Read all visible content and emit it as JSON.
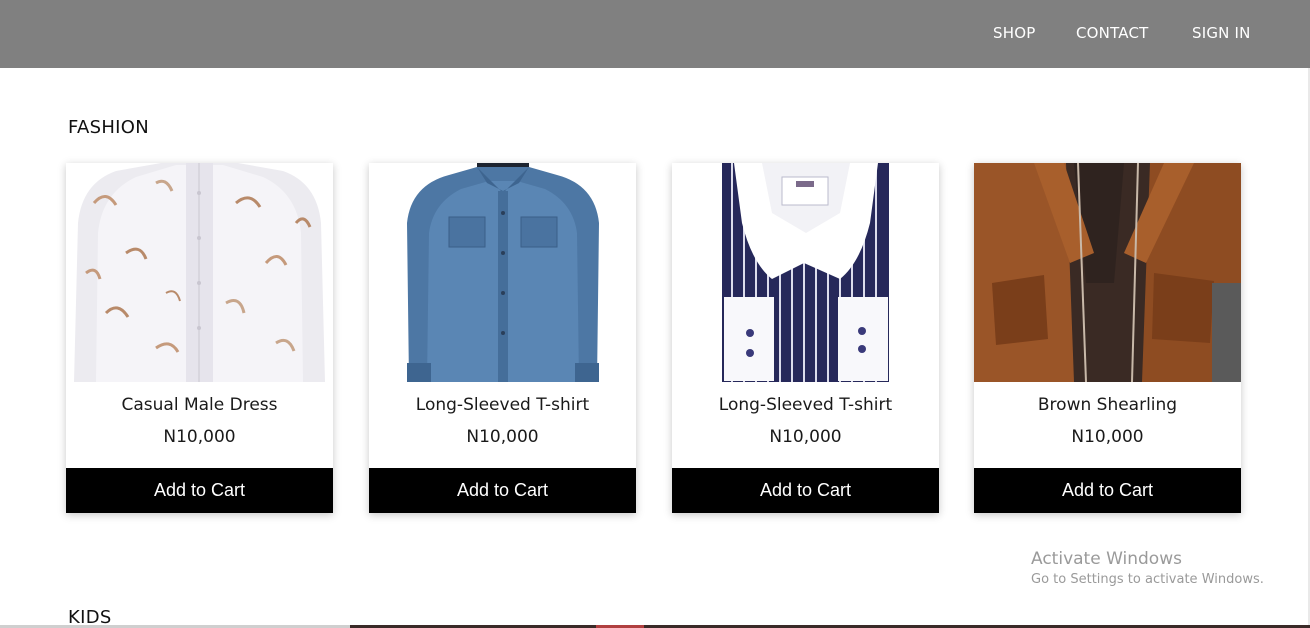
{
  "nav": {
    "shop": "SHOP",
    "contact": "CONTACT",
    "sign_in": "SIGN IN"
  },
  "sections": {
    "fashion": "FASHION",
    "kids": "KIDS"
  },
  "products": [
    {
      "name": "Casual Male Dress",
      "price": "N10,000",
      "button": "Add to Cart",
      "image": "white-patterned-shirt"
    },
    {
      "name": "Long-Sleeved T-shirt",
      "price": "N10,000",
      "button": "Add to Cart",
      "image": "denim-shirt"
    },
    {
      "name": "Long-Sleeved T-shirt",
      "price": "N10,000",
      "button": "Add to Cart",
      "image": "striped-shirt"
    },
    {
      "name": "Brown Shearling",
      "price": "N10,000",
      "button": "Add to Cart",
      "image": "brown-jacket"
    }
  ],
  "watermark": {
    "title": "Activate Windows",
    "subtitle": "Go to Settings to activate Windows."
  },
  "colors": {
    "header_bg": "#808080",
    "button_bg": "#000000",
    "button_text": "#ffffff"
  }
}
